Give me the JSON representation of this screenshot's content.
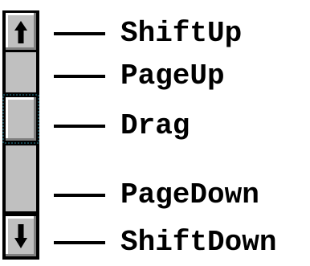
{
  "labels": {
    "shift_up": "ShiftUp",
    "page_up": "PageUp",
    "drag": "Drag",
    "page_down": "PageDown",
    "shift_down": "ShiftDown"
  },
  "icons": {
    "up_arrow": "arrow-up-icon",
    "down_arrow": "arrow-down-icon"
  },
  "colors": {
    "track": "#c0c0c0",
    "button_face": "#c0c0c0",
    "highlight": "#ffffff",
    "shadow": "#808080",
    "text": "#000000"
  }
}
